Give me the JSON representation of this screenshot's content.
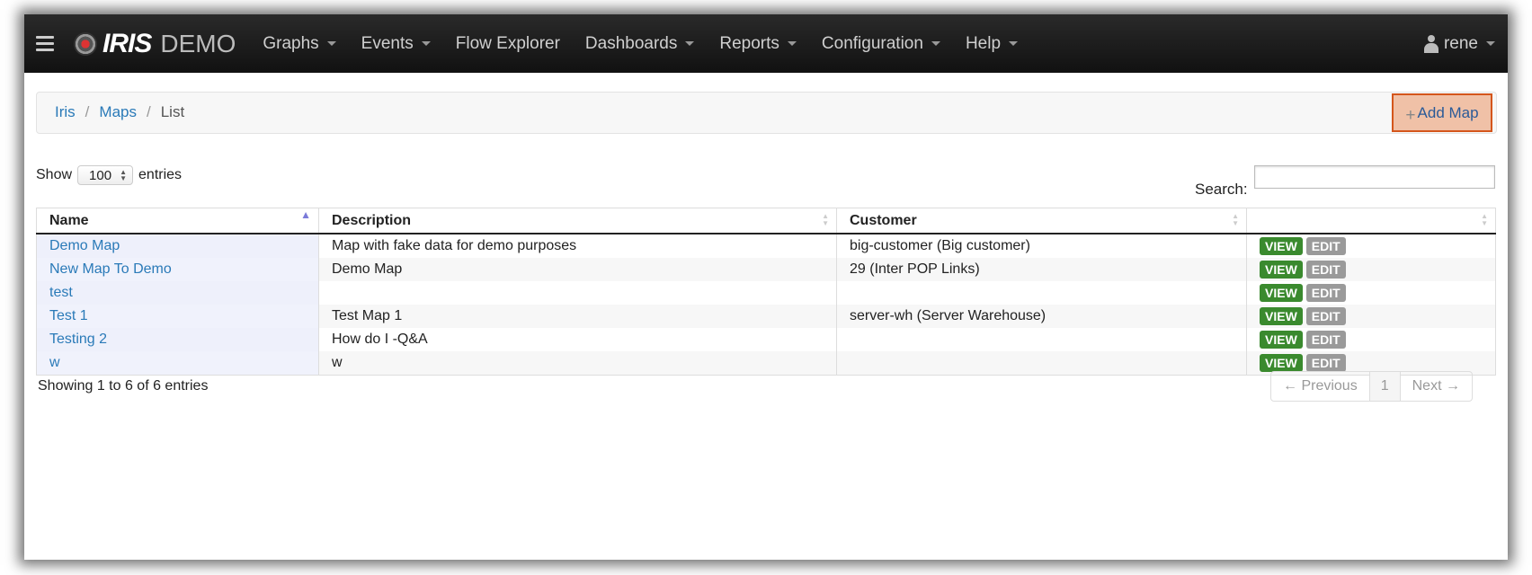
{
  "brand": {
    "logo_text": "IRIS",
    "suffix": "DEMO"
  },
  "nav": {
    "items": [
      {
        "label": "Graphs",
        "dropdown": true
      },
      {
        "label": "Events",
        "dropdown": true
      },
      {
        "label": "Flow Explorer",
        "dropdown": false
      },
      {
        "label": "Dashboards",
        "dropdown": true
      },
      {
        "label": "Reports",
        "dropdown": true
      },
      {
        "label": "Configuration",
        "dropdown": true
      },
      {
        "label": "Help",
        "dropdown": true
      }
    ],
    "user": "rene"
  },
  "breadcrumb": {
    "root": "Iris",
    "section": "Maps",
    "current": "List",
    "separator": "/"
  },
  "add_map_label": "Add Map",
  "controls": {
    "show_label": "Show",
    "page_size": "100",
    "entries_label": "entries",
    "search_label": "Search:",
    "search_value": ""
  },
  "table": {
    "headers": [
      "Name",
      "Description",
      "Customer",
      ""
    ],
    "rows": [
      {
        "name": "Demo Map",
        "description": "Map with fake data for demo purposes",
        "customer": "big-customer (Big customer)"
      },
      {
        "name": "New Map To Demo",
        "description": "Demo Map",
        "customer": "29 (Inter POP Links)"
      },
      {
        "name": "test",
        "description": "",
        "customer": ""
      },
      {
        "name": "Test 1",
        "description": "Test Map 1",
        "customer": "server-wh (Server Warehouse)"
      },
      {
        "name": "Testing 2",
        "description": "How do I -Q&A",
        "customer": ""
      },
      {
        "name": "w",
        "description": "w",
        "customer": ""
      }
    ],
    "view_label": "VIEW",
    "edit_label": "EDIT"
  },
  "footer": {
    "info": "Showing 1 to 6 of 6 entries",
    "prev": "← Previous",
    "page": "1",
    "next": "Next →"
  },
  "colors": {
    "navbar": "#1a1a1a",
    "link": "#2a7ab8",
    "view": "#3a8a2e",
    "edit": "#9a9a9a",
    "add_map_border": "#d4561c"
  }
}
